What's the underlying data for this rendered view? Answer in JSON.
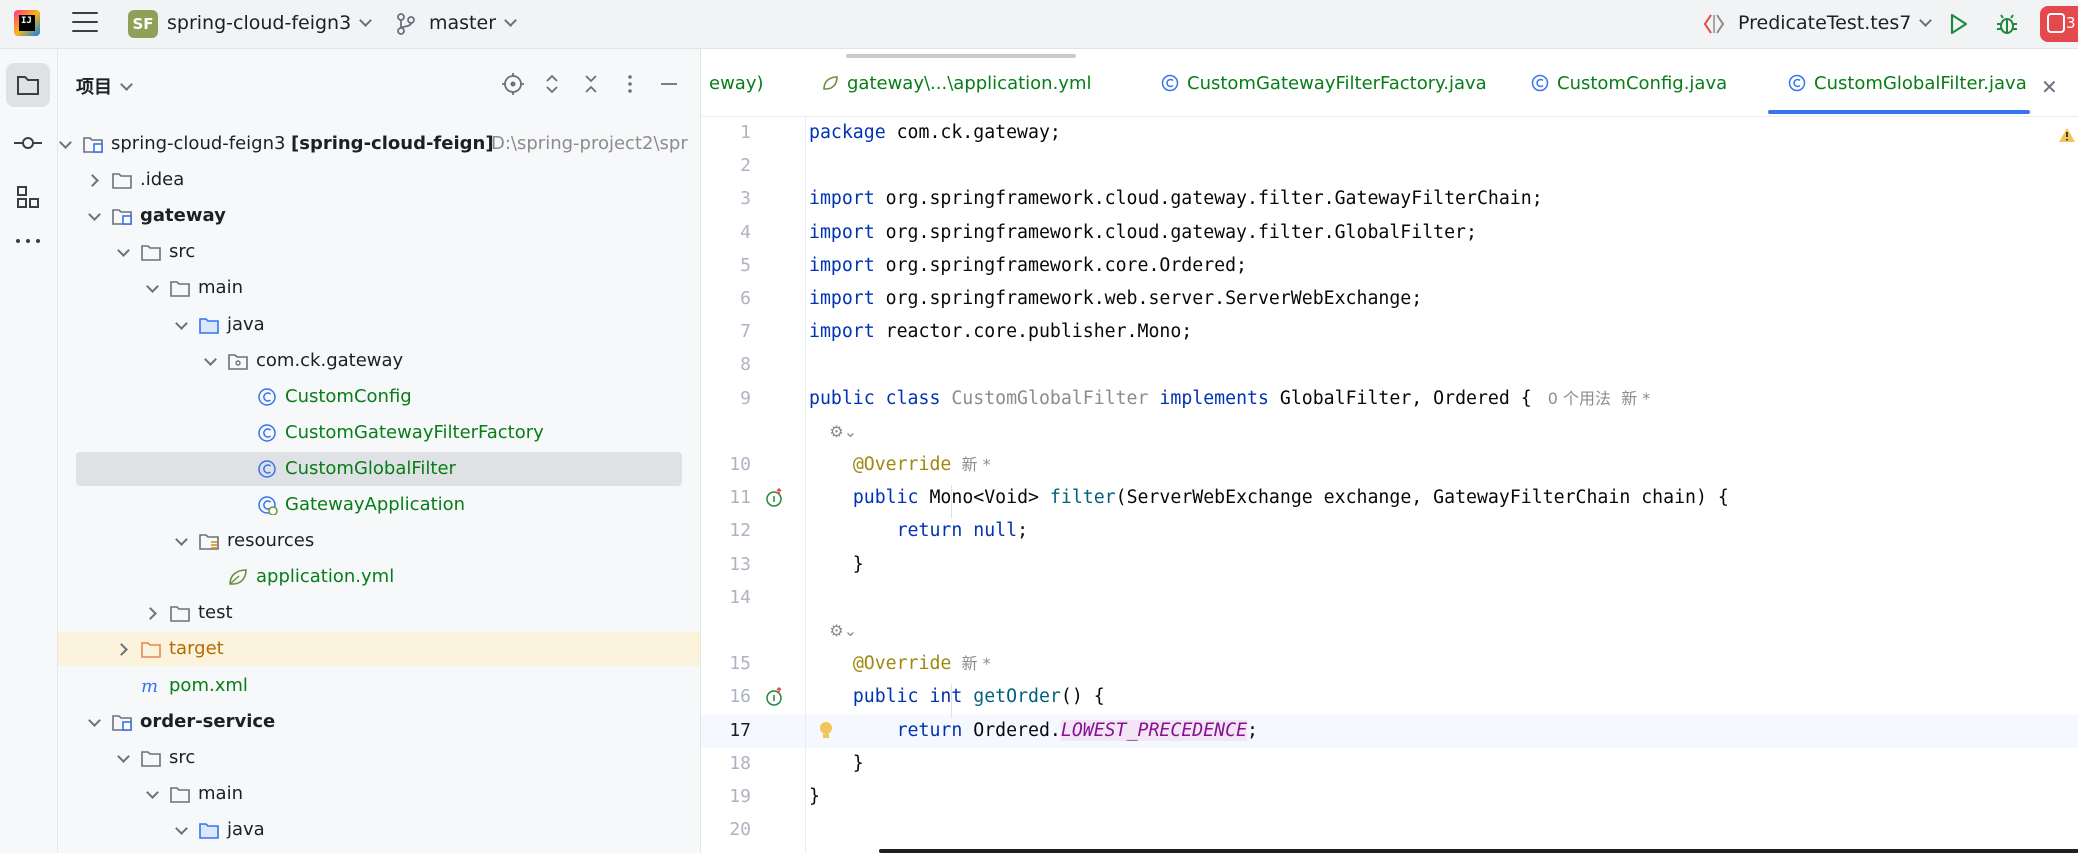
{
  "topbar": {
    "logo_text": "IJ",
    "project_badge": "SF",
    "project_name": "spring-cloud-feign3",
    "branch_name": "master",
    "run_config_name": "PredicateTest.tes7",
    "notification_count": "3"
  },
  "project_panel": {
    "title": "项目",
    "tree": [
      {
        "label": "spring-cloud-feign3",
        "suffix": "[spring-cloud-feign]",
        "path": "D:\\spring-project2\\spr",
        "icon": "module-icon",
        "arrow": "open",
        "indent": 0
      },
      {
        "label": ".idea",
        "icon": "folder-icon",
        "arrow": "closed",
        "indent": 1
      },
      {
        "label": "gateway",
        "icon": "module-icon",
        "arrow": "open",
        "indent": 1,
        "bold": true
      },
      {
        "label": "src",
        "icon": "folder-icon",
        "arrow": "open",
        "indent": 2
      },
      {
        "label": "main",
        "icon": "folder-icon",
        "arrow": "open",
        "indent": 3
      },
      {
        "label": "java",
        "icon": "source-folder-icon",
        "arrow": "open",
        "indent": 4
      },
      {
        "label": "com.ck.gateway",
        "icon": "package-icon",
        "arrow": "open",
        "indent": 5
      },
      {
        "label": "CustomConfig",
        "icon": "class-icon",
        "arrow": "none",
        "indent": 6,
        "green": true
      },
      {
        "label": "CustomGatewayFilterFactory",
        "icon": "class-icon",
        "arrow": "none",
        "indent": 6,
        "green": true
      },
      {
        "label": "CustomGlobalFilter",
        "icon": "class-icon",
        "arrow": "none",
        "indent": 6,
        "green": true,
        "selected": true
      },
      {
        "label": "GatewayApplication",
        "icon": "spring-boot-class-icon",
        "arrow": "none",
        "indent": 6,
        "green": true
      },
      {
        "label": "resources",
        "icon": "resources-folder-icon",
        "arrow": "open",
        "indent": 4
      },
      {
        "label": "application.yml",
        "icon": "spring-yml-icon",
        "arrow": "none",
        "indent": 5,
        "green": true
      },
      {
        "label": "test",
        "icon": "folder-icon",
        "arrow": "closed",
        "indent": 3
      },
      {
        "label": "target",
        "icon": "excluded-folder-icon",
        "arrow": "closed",
        "indent": 2,
        "excluded": true
      },
      {
        "label": "pom.xml",
        "icon": "maven-icon",
        "arrow": "none",
        "indent": 2,
        "green": true
      },
      {
        "label": "order-service",
        "icon": "module-icon",
        "arrow": "open",
        "indent": 1,
        "bold": true
      },
      {
        "label": "src",
        "icon": "folder-icon",
        "arrow": "open",
        "indent": 2
      },
      {
        "label": "main",
        "icon": "folder-icon",
        "arrow": "open",
        "indent": 3
      },
      {
        "label": "java",
        "icon": "source-folder-icon",
        "arrow": "open",
        "indent": 4
      }
    ]
  },
  "editor": {
    "tabs": [
      {
        "label": "eway)",
        "icon": "none"
      },
      {
        "label": "gateway\\...\\application.yml",
        "icon": "spring-yml-icon"
      },
      {
        "label": "CustomGatewayFilterFactory.java",
        "icon": "class-icon"
      },
      {
        "label": "CustomConfig.java",
        "icon": "class-icon"
      },
      {
        "label": "CustomGlobalFilter.java",
        "icon": "class-icon",
        "active": true
      }
    ],
    "lines": [
      {
        "n": "1",
        "code": [
          [
            "kw",
            "package"
          ],
          [
            "t",
            " com.ck.gateway;"
          ]
        ]
      },
      {
        "n": "2",
        "code": []
      },
      {
        "n": "3",
        "code": [
          [
            "kw",
            "import"
          ],
          [
            "t",
            " org.springframework.cloud.gateway.filter.GatewayFilterChain;"
          ]
        ]
      },
      {
        "n": "4",
        "code": [
          [
            "kw",
            "import"
          ],
          [
            "t",
            " org.springframework.cloud.gateway.filter.GlobalFilter;"
          ]
        ]
      },
      {
        "n": "5",
        "code": [
          [
            "kw",
            "import"
          ],
          [
            "t",
            " org.springframework.core.Ordered;"
          ]
        ]
      },
      {
        "n": "6",
        "code": [
          [
            "kw",
            "import"
          ],
          [
            "t",
            " org.springframework.web.server.ServerWebExchange;"
          ]
        ]
      },
      {
        "n": "7",
        "code": [
          [
            "kw",
            "import"
          ],
          [
            "t",
            " reactor.core.publisher.Mono;"
          ]
        ]
      },
      {
        "n": "8",
        "code": []
      },
      {
        "n": "9",
        "code": [
          [
            "kw",
            "public class"
          ],
          [
            "t",
            " "
          ],
          [
            "muted",
            "CustomGlobalFilter"
          ],
          [
            "t",
            " "
          ],
          [
            "kw",
            "implements"
          ],
          [
            "t",
            " GlobalFilter, Ordered { "
          ],
          [
            "hint",
            " 0 个用法  新 *"
          ]
        ]
      },
      {
        "n": "",
        "code": [
          [
            "hint",
            "    ⚙⌄"
          ]
        ],
        "inlay": true
      },
      {
        "n": "10",
        "code": [
          [
            "t",
            "    "
          ],
          [
            "ann",
            "@Override"
          ],
          [
            "hint",
            "  新 *"
          ]
        ]
      },
      {
        "n": "11",
        "code": [
          [
            "t",
            "    "
          ],
          [
            "kw",
            "public"
          ],
          [
            "t",
            " Mono<Void> "
          ],
          [
            "fn",
            "filter"
          ],
          [
            "t",
            "(ServerWebExchange exchange, GatewayFilterChain chain) {"
          ]
        ],
        "gutter": "override-icon"
      },
      {
        "n": "12",
        "code": [
          [
            "t",
            "        "
          ],
          [
            "kw",
            "return null"
          ],
          [
            "t",
            ";"
          ]
        ]
      },
      {
        "n": "13",
        "code": [
          [
            "t",
            "    }"
          ]
        ]
      },
      {
        "n": "14",
        "code": []
      },
      {
        "n": "",
        "code": [
          [
            "hint",
            "    ⚙⌄"
          ]
        ],
        "inlay": true
      },
      {
        "n": "15",
        "code": [
          [
            "t",
            "    "
          ],
          [
            "ann",
            "@Override"
          ],
          [
            "hint",
            "  新 *"
          ]
        ]
      },
      {
        "n": "16",
        "code": [
          [
            "t",
            "    "
          ],
          [
            "kw",
            "public int"
          ],
          [
            "t",
            " "
          ],
          [
            "fn",
            "getOrder"
          ],
          [
            "t",
            "() {"
          ]
        ],
        "gutter": "override-icon"
      },
      {
        "n": "17",
        "code": [
          [
            "t",
            "        "
          ],
          [
            "kw",
            "return"
          ],
          [
            "t",
            " Ordered."
          ],
          [
            "const",
            "LOWEST_PRECEDENCE"
          ],
          [
            "t",
            ";"
          ]
        ],
        "current": true
      },
      {
        "n": "18",
        "code": [
          [
            "t",
            "    }"
          ]
        ]
      },
      {
        "n": "19",
        "code": [
          [
            "t",
            "}"
          ]
        ]
      },
      {
        "n": "20",
        "code": []
      }
    ]
  },
  "colors": {
    "accent": "#3574f0",
    "keyword": "#0033b3",
    "annotation": "#9e880d",
    "method": "#00627a",
    "constant": "#871094",
    "vcs_added": "#067d17",
    "notification": "#e5484d"
  }
}
